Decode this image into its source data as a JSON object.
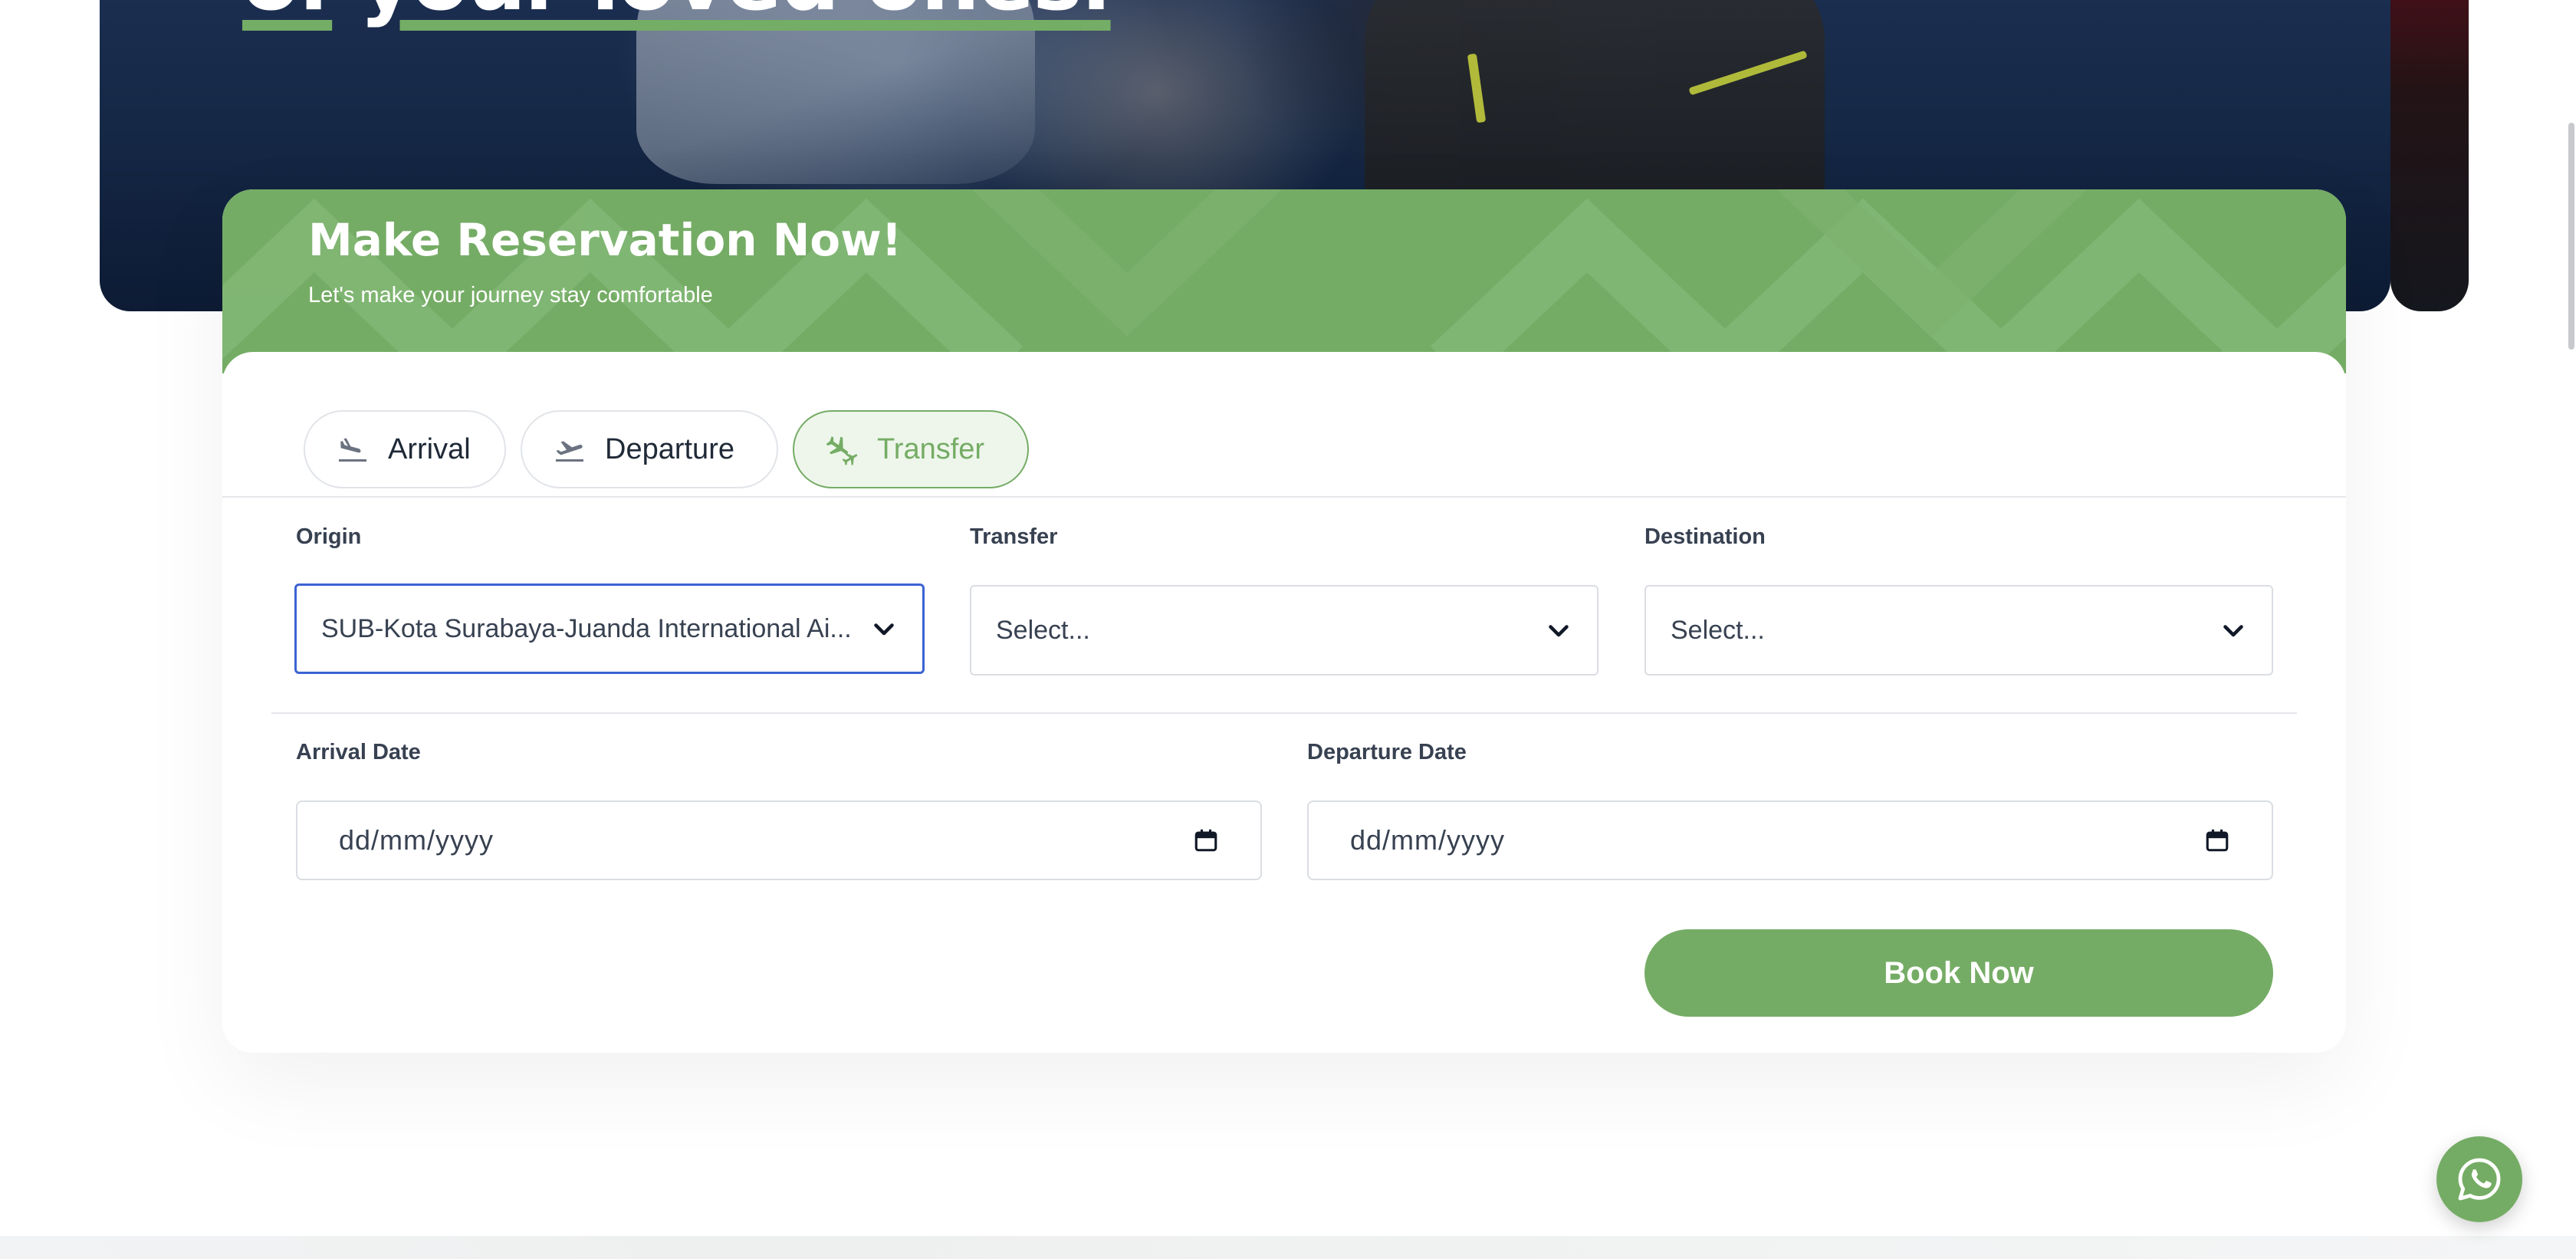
{
  "hero": {
    "title_line": "of your loved ones.",
    "title_part1": "of",
    "title_part2": "your loved ones",
    "title_period": "."
  },
  "reservation": {
    "title": "Make Reservation Now!",
    "subtitle": "Let's make your journey stay comfortable",
    "tabs": [
      {
        "label": "Arrival",
        "icon": "plane-landing-icon",
        "active": false
      },
      {
        "label": "Departure",
        "icon": "plane-takeoff-icon",
        "active": false
      },
      {
        "label": "Transfer",
        "icon": "plane-transfer-icon",
        "active": true
      }
    ],
    "fields": {
      "origin": {
        "label": "Origin",
        "value": "SUB-Kota Surabaya-Juanda International Ai..."
      },
      "transfer": {
        "label": "Transfer",
        "placeholder": "Select..."
      },
      "destination": {
        "label": "Destination",
        "placeholder": "Select..."
      },
      "arrival_date": {
        "label": "Arrival Date",
        "placeholder": "dd/mm/yyyy"
      },
      "departure_date": {
        "label": "Departure Date",
        "placeholder": "dd/mm/yyyy"
      }
    },
    "book_button": "Book Now"
  },
  "floating": {
    "whatsapp_icon": "whatsapp-icon"
  },
  "colors": {
    "accent_green": "#75ac65",
    "active_tab_bg": "#eef6eb",
    "focus_blue": "#3b63d3",
    "hero_navy": "#152846"
  }
}
